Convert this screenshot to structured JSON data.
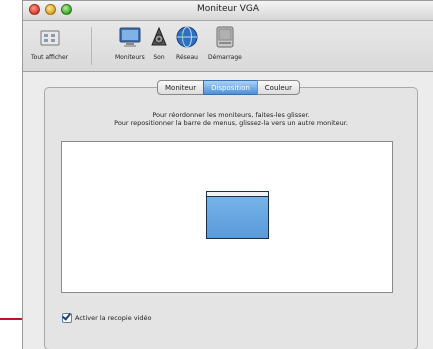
{
  "window": {
    "title": "Moniteur VGA"
  },
  "toolbar": {
    "show_all": "Tout afficher",
    "items": [
      {
        "label": "Moniteurs",
        "icon": "monitor-icon"
      },
      {
        "label": "Son",
        "icon": "speaker-icon"
      },
      {
        "label": "Réseau",
        "icon": "globe-icon"
      },
      {
        "label": "Démarrage",
        "icon": "hard-drive-icon"
      }
    ]
  },
  "tabs": [
    {
      "label": "Moniteur",
      "active": false
    },
    {
      "label": "Disposition",
      "active": true
    },
    {
      "label": "Couleur",
      "active": false
    }
  ],
  "instructions": {
    "line1": "Pour réordonner les moniteurs, faites-les glisser.",
    "line2": "Pour repositionner la barre de menus, glissez-la vers un autre moniteur."
  },
  "mirror": {
    "label": "Activer la recopie vidéo",
    "checked": true
  },
  "colors": {
    "tab_active": "#5a9ad8",
    "monitor_fill": "#6aa8e2",
    "callout": "#c8102e"
  }
}
